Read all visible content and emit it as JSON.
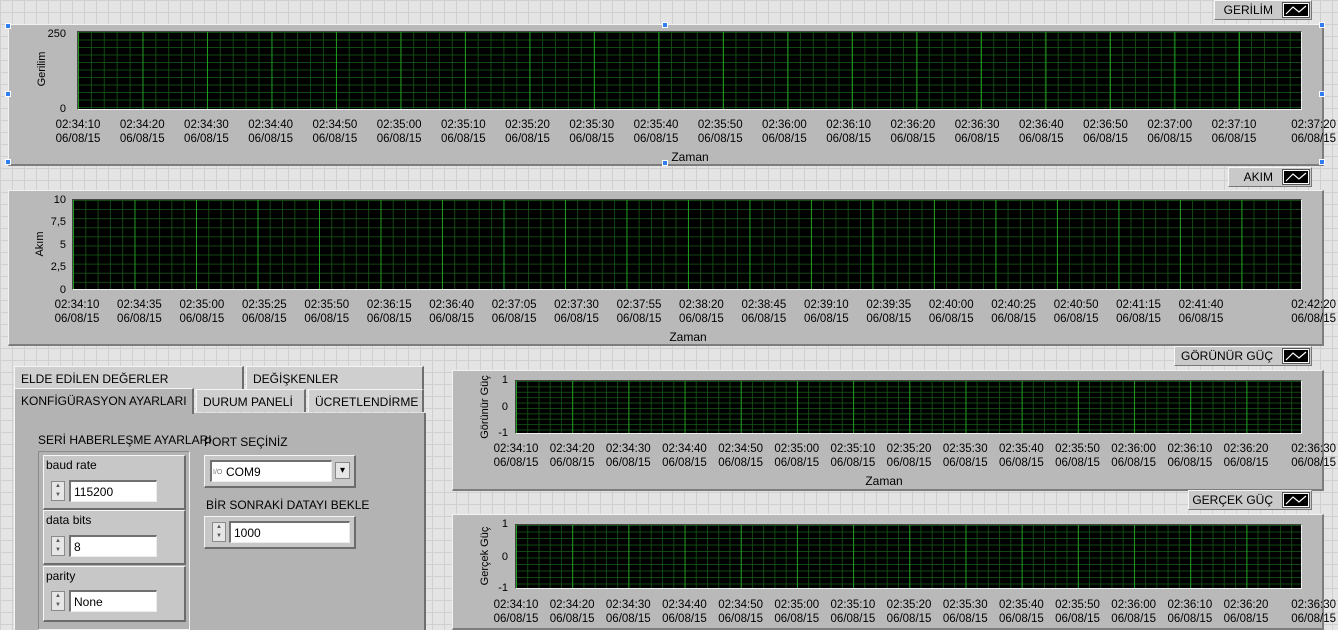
{
  "gerilim": {
    "legend": "GERİLİM",
    "ylabel": "Gerilim",
    "yticks": [
      "250",
      "0"
    ],
    "xlabel": "Zaman",
    "date": "06/08/15",
    "times": [
      "02:34:10",
      "02:34:20",
      "02:34:30",
      "02:34:40",
      "02:34:50",
      "02:35:00",
      "02:35:10",
      "02:35:20",
      "02:35:30",
      "02:35:40",
      "02:35:50",
      "02:36:00",
      "02:36:10",
      "02:36:20",
      "02:36:30",
      "02:36:40",
      "02:36:50",
      "02:37:00",
      "02:37:10",
      "02:37:20"
    ]
  },
  "akim": {
    "legend": "AKIM",
    "ylabel": "Akım",
    "yticks": [
      "10",
      "7,5",
      "5",
      "2,5",
      "0"
    ],
    "xlabel": "Zaman",
    "date": "06/08/15",
    "times": [
      "02:34:10",
      "02:34:35",
      "02:35:00",
      "02:35:25",
      "02:35:50",
      "02:36:15",
      "02:36:40",
      "02:37:05",
      "02:37:30",
      "02:37:55",
      "02:38:20",
      "02:38:45",
      "02:39:10",
      "02:39:35",
      "02:40:00",
      "02:40:25",
      "02:40:50",
      "02:41:15",
      "02:41:40",
      "02:42:20"
    ]
  },
  "gorunur": {
    "legend": "GÖRÜNÜR GÜÇ",
    "ylabel": "Görünür Güç",
    "yticks": [
      "1",
      "0",
      "-1"
    ],
    "xlabel": "Zaman",
    "date": "06/08/15",
    "times": [
      "02:34:10",
      "02:34:20",
      "02:34:30",
      "02:34:40",
      "02:34:50",
      "02:35:00",
      "02:35:10",
      "02:35:20",
      "02:35:30",
      "02:35:40",
      "02:35:50",
      "02:36:00",
      "02:36:10",
      "02:36:20",
      "02:36:30"
    ]
  },
  "gercek": {
    "legend": "GERÇEK GÜÇ",
    "ylabel": "Gerçek Güç",
    "yticks": [
      "1",
      "0",
      "-1"
    ],
    "date": "06/08/15",
    "times": [
      "02:34:10",
      "02:34:20",
      "02:34:30",
      "02:34:40",
      "02:34:50",
      "02:35:00",
      "02:35:10",
      "02:35:20",
      "02:35:30",
      "02:35:40",
      "02:35:50",
      "02:36:00",
      "02:36:10",
      "02:36:20",
      "02:36:30"
    ]
  },
  "tabs": {
    "row1": [
      "ELDE EDİLEN DEĞERLER",
      "DEĞİŞKENLER"
    ],
    "row2": [
      "KONFİGÜRASYON AYARLARI",
      "DURUM PANELİ",
      "ÜCRETLENDİRME"
    ]
  },
  "config": {
    "serial_group_label": "SERİ HABERLEŞME AYARLARI",
    "baud_label": "baud rate",
    "baud_value": "115200",
    "databits_label": "data bits",
    "databits_value": "8",
    "parity_label": "parity",
    "parity_value": "None",
    "port_label": "PORT SEÇİNİZ",
    "port_value": "COM9",
    "port_io_glyph": "I/O",
    "wait_label": "BİR SONRAKİ DATAYI BEKLE",
    "wait_value": "1000"
  },
  "icons": {
    "spin_up": "▲",
    "spin_down": "▼",
    "dropdown": "▾"
  },
  "colors": {
    "plot_bg": "#000000",
    "grid_major": "#28c828",
    "grid_minor": "#145514",
    "panel": "#b3b3b3"
  }
}
